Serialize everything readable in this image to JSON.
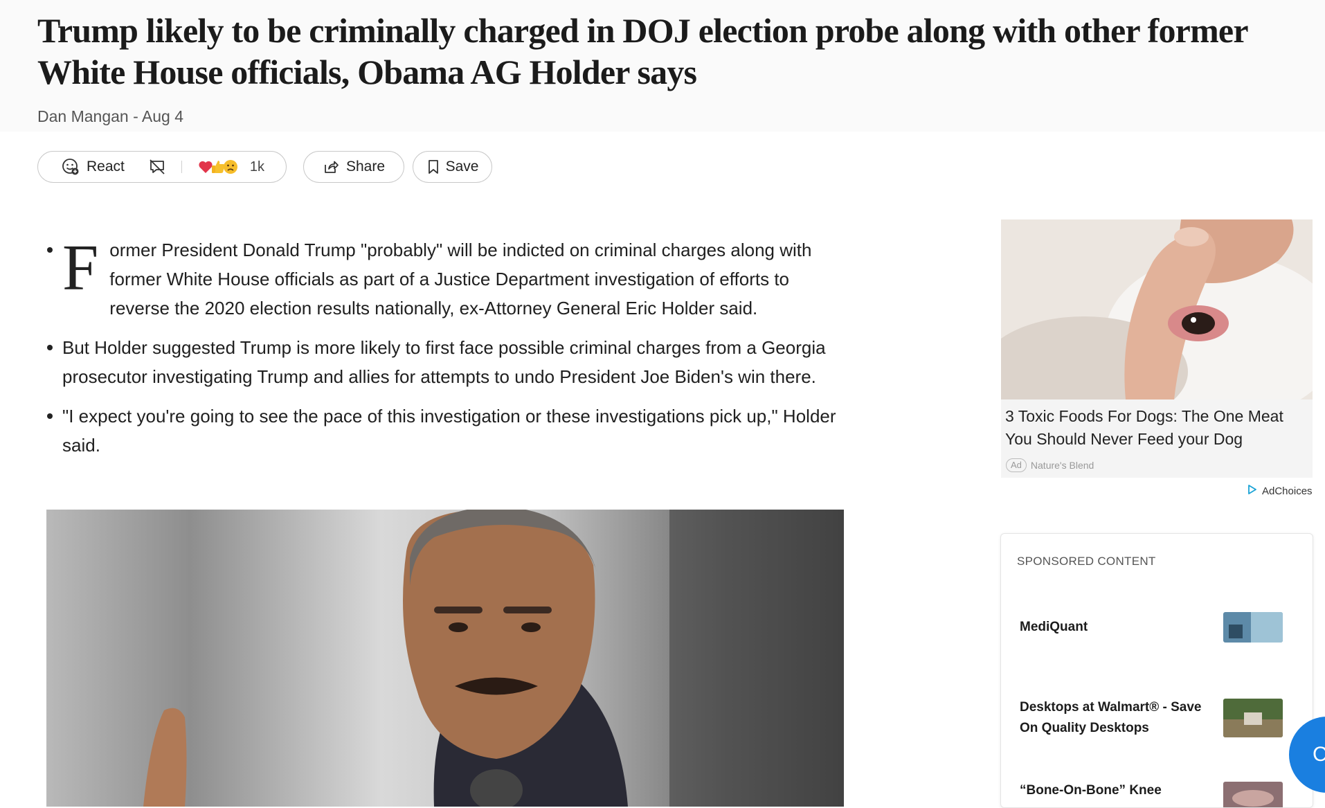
{
  "article": {
    "headline": "Trump likely to be criminally charged in DOJ election probe along with other former White House officials, Obama AG Holder says",
    "author": "Dan Mangan",
    "date": "Aug 4",
    "byline_sep": " - "
  },
  "actions": {
    "react_label": "React",
    "reaction_count": "1k",
    "share_label": "Share",
    "save_label": "Save"
  },
  "bullets": {
    "first_dropcap": "F",
    "first_rest": "ormer President Donald Trump \"probably\" will be indicted on criminal charges along with former White House officials as part of a Justice Department investigation of efforts to reverse the 2020 election results nationally, ex-Attorney General Eric Holder said.",
    "second": "But Holder suggested Trump is more likely to first face possible criminal charges from a Georgia prosecutor investigating Trump and allies for attempts to undo President Joe Biden's win there.",
    "third": "\"I expect you're going to see the pace of this investigation or these investigations pick up,\" Holder said."
  },
  "ad": {
    "title": "3 Toxic Foods For Dogs: The One Meat You Should Never Feed your Dog",
    "badge": "Ad",
    "source": "Nature's Blend",
    "adchoices": "AdChoices"
  },
  "sponsored": {
    "heading": "SPONSORED CONTENT",
    "items": [
      {
        "title": "MediQuant"
      },
      {
        "title": "Desktops at Walmart® - Save On Quality Desktops"
      },
      {
        "title": "“Bone-On-Bone” Knee"
      }
    ]
  },
  "fab": {
    "label": "C"
  },
  "icons": [
    "react-icon",
    "comment-off-icon",
    "share-icon",
    "bookmark-icon",
    "adchoices-icon"
  ]
}
